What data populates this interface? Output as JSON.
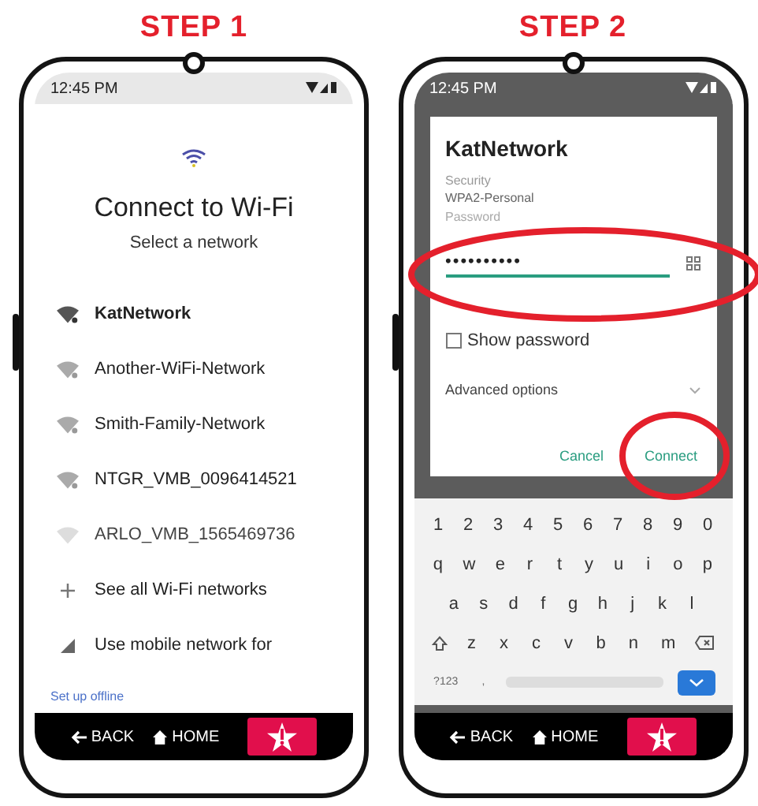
{
  "steps": [
    {
      "kind": "wifi_list",
      "heading": "STEP 1",
      "status_time": "12:45 PM",
      "title": "Connect to Wi-Fi",
      "subtitle": "Select a network",
      "items": [
        {
          "kind": "network",
          "label": "KatNetwork",
          "strong": true
        },
        {
          "kind": "network",
          "label": "Another-WiFi-Network",
          "strong": false
        },
        {
          "kind": "network",
          "label": "Smith-Family-Network",
          "strong": false
        },
        {
          "kind": "network",
          "label": "NTGR_VMB_0096414521",
          "strong": false
        },
        {
          "kind": "faint",
          "label": "ARLO_VMB_1565469736",
          "strong": false
        },
        {
          "kind": "add",
          "label": "See all Wi-Fi networks"
        },
        {
          "kind": "mobile",
          "label": "Use mobile network for"
        }
      ],
      "link": "Set up offline",
      "nav": {
        "back": "BACK",
        "home": "HOME"
      }
    },
    {
      "kind": "password_dialog",
      "heading": "STEP 2",
      "status_time": "12:45 PM",
      "dialog_title": "KatNetwork",
      "security_label": "Security",
      "security_value": "WPA2-Personal",
      "password_label": "Password",
      "password_value": "••••••••••",
      "show_password": {
        "label": "Show password",
        "checked": false
      },
      "advanced": "Advanced options",
      "buttons": [
        "Cancel",
        "Connect"
      ],
      "keyboard": {
        "rows": [
          [
            "1",
            "2",
            "3",
            "4",
            "5",
            "6",
            "7",
            "8",
            "9",
            "0"
          ],
          [
            "q",
            "w",
            "e",
            "r",
            "t",
            "y",
            "u",
            "i",
            "o",
            "p"
          ],
          [
            "a",
            "s",
            "d",
            "f",
            "g",
            "h",
            "j",
            "k",
            "l"
          ],
          [
            "z",
            "x",
            "c",
            "v",
            "b",
            "n",
            "m"
          ]
        ],
        "symbols_key": "?123",
        "comma_key": ","
      },
      "nav": {
        "back": "BACK",
        "home": "HOME"
      }
    }
  ]
}
